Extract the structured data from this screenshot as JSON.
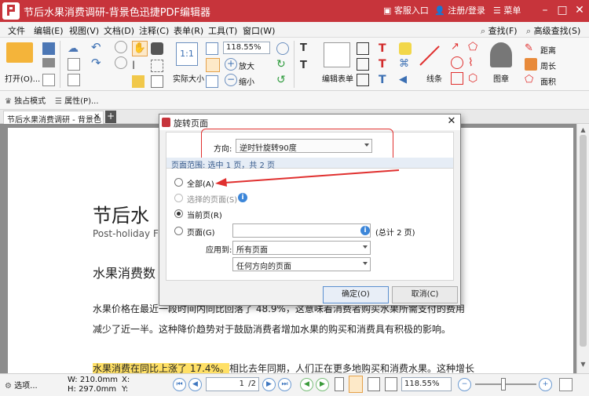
{
  "window": {
    "title": "节后水果消费调研-背景色迅捷PDF编辑器",
    "service": "客服入口",
    "login": "注册/登录",
    "menu": "菜单"
  },
  "menubar": {
    "items": [
      "文件",
      "编辑(E)",
      "视图(V)",
      "文档(D)",
      "注释(C)",
      "表单(R)",
      "工具(T)",
      "窗口(W)"
    ],
    "find": "查找(F)",
    "advanced_find": "高级查找(S)"
  },
  "toolbar": {
    "open": "打开(O)...",
    "actual_size": "实际大小",
    "zoom_value": "118.55%",
    "zoom_in": "放大",
    "zoom_out": "缩小",
    "edit_form": "编辑表单",
    "line": "线条",
    "stamp": "图章",
    "distance": "距离",
    "perimeter": "周长",
    "area": "面积"
  },
  "toolbar2": {
    "exclusive_mode": "独占模式",
    "properties": "属性(P)..."
  },
  "tabs": {
    "doc_tab": "节后水果消费调研 - 背景色"
  },
  "document": {
    "heading": "节后水",
    "subheading": "Post-holiday Fr",
    "section": "水果消费数",
    "para1": "水果价格在最近一段时间内同比回落了 48.9%，这意味着消费者购买水果所需支付的费用",
    "para2": "减少了近一半。这种降价趋势对于鼓励消费者增加水果的购买和消费具有积极的影响。",
    "para3_highlight": "水果消费在同比上涨了 17.4%。",
    "para3_rest": "相比去年同期，人们正在更多地购买和消费水果。这种增长"
  },
  "dialog": {
    "title": "旋转页面",
    "direction_label": "方向:",
    "direction_value": "逆时针旋转90度",
    "range_header": "页面范围: 选中 1 页，共 2 页",
    "opt_all": "全部(A)",
    "opt_selected": "选择的页面(S)",
    "opt_current": "当前页(R)",
    "opt_pages": "页面(G)",
    "total": "(总计 2 页)",
    "apply_label": "应用到:",
    "apply_value": "所有页面",
    "orientation_value": "任何方向的页面",
    "ok": "确定(O)",
    "cancel": "取消(C)"
  },
  "status": {
    "options": "选项...",
    "width": "W: 210.0mm",
    "height": "H: 297.0mm",
    "x": "X:",
    "y": "Y:",
    "page": "1",
    "page_total": "/2",
    "zoom": "118.55%"
  },
  "colors": {
    "titlebar": "#c7343b",
    "highlight": "#ffe066",
    "annotation": "#e0302f"
  }
}
